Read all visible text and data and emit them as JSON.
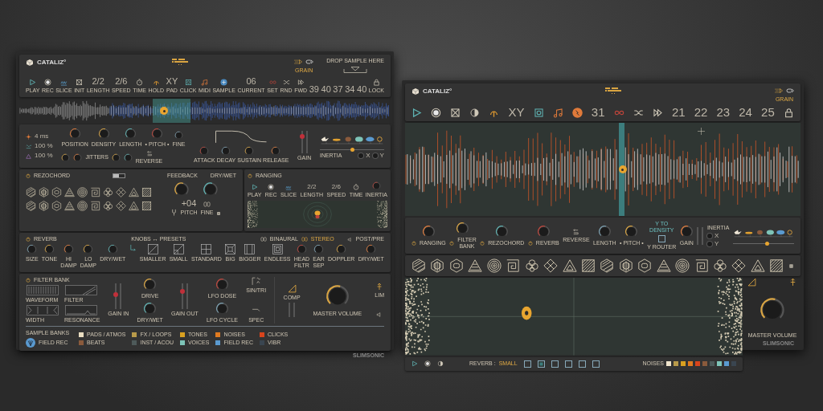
{
  "left_window": {
    "logo": "CATALIZ°",
    "mode_label": "GRAIN",
    "toolbar": [
      {
        "kind": "button",
        "label": "PLAY"
      },
      {
        "kind": "button",
        "label": "REC"
      },
      {
        "kind": "button",
        "label": "SLICE"
      },
      {
        "kind": "button",
        "label": "INIT"
      },
      {
        "kind": "readout",
        "value": "2/2",
        "label": "LENGTH"
      },
      {
        "kind": "readout",
        "value": "2/6",
        "label": "SPEED"
      },
      {
        "kind": "button",
        "label": "TIME"
      },
      {
        "kind": "button",
        "label": "HOLD"
      },
      {
        "kind": "readout",
        "value": "XY",
        "label": "PAD"
      },
      {
        "kind": "button",
        "label": "CLICK"
      },
      {
        "kind": "button",
        "label": "MIDI"
      },
      {
        "kind": "button",
        "label": "SAMPLE"
      },
      {
        "kind": "readout",
        "value": "06",
        "label": "CURRENT"
      },
      {
        "kind": "button",
        "label": "SET"
      },
      {
        "kind": "button",
        "label": "RND"
      },
      {
        "kind": "button",
        "label": "FWD"
      },
      {
        "kind": "readout",
        "value": "39"
      },
      {
        "kind": "readout",
        "value": "40"
      },
      {
        "kind": "readout",
        "value": "37"
      },
      {
        "kind": "readout",
        "value": "34"
      },
      {
        "kind": "readout",
        "value": "40"
      },
      {
        "kind": "button",
        "label": "LOCK"
      }
    ],
    "drop_zone": "DROP SAMPLE HERE",
    "grain": {
      "stats": [
        "4 ms",
        "100 %",
        "100 %"
      ],
      "knobs": [
        "POSITION",
        "DENSITY",
        "LENGTH",
        "• PITCH •",
        "FINE"
      ],
      "jitters": "JITTERS",
      "reverse": "REVERSE",
      "envelope": [
        "ATTACK",
        "DECAY",
        "SUSTAIN",
        "RELEASE"
      ],
      "gain": {
        "label": "GAIN",
        "level": 0.75
      },
      "inertia": {
        "label": "INERTIA",
        "level": 0.5
      },
      "axes": [
        "X",
        "Y"
      ]
    },
    "rezochord": {
      "title": "REZOCHORD",
      "toggle": {
        "on": true
      },
      "feedback": "FEEDBACK",
      "dry_wet": "DRY/WET",
      "pitch_value": "+04",
      "pitch": "PITCH",
      "fine": "FINE"
    },
    "ranging": {
      "title": "RANGING",
      "controls": [
        {
          "kind": "button",
          "label": "PLAY"
        },
        {
          "kind": "button",
          "label": "REC"
        },
        {
          "kind": "button",
          "label": "SLICE"
        },
        {
          "kind": "readout",
          "value": "2/2",
          "label": "LENGTH"
        },
        {
          "kind": "readout",
          "value": "2/6",
          "label": "SPEED"
        },
        {
          "kind": "button",
          "label": "TIME"
        }
      ],
      "inertia": "INERTIA"
    },
    "reverb": {
      "title": "REVERB",
      "mode": "KNOBS ↔ PRESETS",
      "post_pre": "POST/PRE",
      "knobs": [
        "SIZE",
        "TONE",
        "HI DAMP",
        "LO DAMP",
        "DRY/WET"
      ],
      "presets": [
        "SMALLER",
        "SMALL",
        "STANDARD",
        "BIG",
        "BIGGER",
        "ENDLESS"
      ],
      "spatial": [
        "HEAD FILTR",
        "EAR SEP",
        "DOPPLER",
        "DRY/WET"
      ],
      "outputs": [
        {
          "label": "BINAURAL",
          "selected": false
        },
        {
          "label": "STEREO",
          "selected": true
        }
      ]
    },
    "filter_bank": {
      "title": "FILTER BANK",
      "displays": [
        "WAVEFORM",
        "FILTER",
        "WIDTH",
        "RESONANCE"
      ],
      "gain_in": {
        "label": "GAIN IN",
        "level": 0.55
      },
      "knobs": [
        "DRIVE",
        "DRY/WET"
      ],
      "gain_out": {
        "label": "GAIN OUT",
        "level": 0.7
      },
      "lfo": [
        "LFO DOSE",
        "LFO CYCLE"
      ],
      "shapes": [
        "SIN/TRI",
        "SPEC"
      ]
    },
    "sample_banks": {
      "title": "SAMPLE BANKS",
      "current": "FIELD REC",
      "banks": [
        {
          "label": "PADS / ATMOS",
          "color": "#e8dcc0"
        },
        {
          "label": "FX / LOOPS",
          "color": "#b89a4a"
        },
        {
          "label": "TONES",
          "color": "#d9a020"
        },
        {
          "label": "NOISES",
          "color": "#e07a20"
        },
        {
          "label": "CLICKS",
          "color": "#d8441c"
        },
        {
          "label": "BEATS",
          "color": "#8a5a3c"
        },
        {
          "label": "INST / ACOU",
          "color": "#4e5a5a"
        },
        {
          "label": "VOICES",
          "color": "#7ec4b8"
        },
        {
          "label": "FIELD REC",
          "color": "#5a9ad0"
        },
        {
          "label": "VIBR",
          "color": "#3a4550"
        }
      ]
    },
    "master": {
      "comp": "COMP",
      "lim": "LIM",
      "volume": "MASTER VOLUME"
    },
    "brand": "SLIMSONIC"
  },
  "right_window": {
    "logo": "CATALIZ°",
    "mode_label": "GRAIN",
    "toolbar": [
      {
        "kind": "button"
      },
      {
        "kind": "button"
      },
      {
        "kind": "button"
      },
      {
        "kind": "button"
      },
      {
        "kind": "button"
      },
      {
        "kind": "readout",
        "value": "XY"
      },
      {
        "kind": "button"
      },
      {
        "kind": "button"
      },
      {
        "kind": "button"
      },
      {
        "kind": "readout",
        "value": "31"
      },
      {
        "kind": "button"
      },
      {
        "kind": "button"
      },
      {
        "kind": "button"
      },
      {
        "kind": "readout",
        "value": "21"
      },
      {
        "kind": "readout",
        "value": "22"
      },
      {
        "kind": "readout",
        "value": "23"
      },
      {
        "kind": "readout",
        "value": "24"
      },
      {
        "kind": "readout",
        "value": "25"
      },
      {
        "kind": "button"
      }
    ],
    "modules": [
      "RANGING",
      "FILTER BANK",
      "REZOCHORD",
      "REVERB"
    ],
    "reverse": "REVERSE",
    "knobs": [
      "LENGTH",
      "• PITCH •"
    ],
    "y_to_density": "Y TO DENSITY",
    "y_router": {
      "label": "Y ROUTER",
      "checked": false
    },
    "gain": "GAIN",
    "inertia": {
      "label": "INERTIA",
      "level": 0.55
    },
    "axes": [
      "X",
      "Y"
    ],
    "reverb_label": "REVERB :",
    "reverb_preset": "SMALL",
    "presets": [
      {
        "selected": false
      },
      {
        "selected": true
      },
      {
        "selected": false
      },
      {
        "selected": false
      },
      {
        "selected": false
      },
      {
        "selected": false
      }
    ],
    "noises_label": "NOISES",
    "swatches": [
      {
        "color": "#efe4cc"
      },
      {
        "color": "#b89a4a"
      },
      {
        "color": "#d9a020"
      },
      {
        "color": "#e07a20"
      },
      {
        "color": "#d8441c"
      },
      {
        "color": "#8a5a3c"
      },
      {
        "color": "#4e5a5a"
      },
      {
        "color": "#7ec4b8"
      },
      {
        "color": "#5a9ad0"
      },
      {
        "color": "#3a4550"
      }
    ],
    "master_volume": "MASTER VOLUME",
    "brand": "SLIMSONIC"
  }
}
